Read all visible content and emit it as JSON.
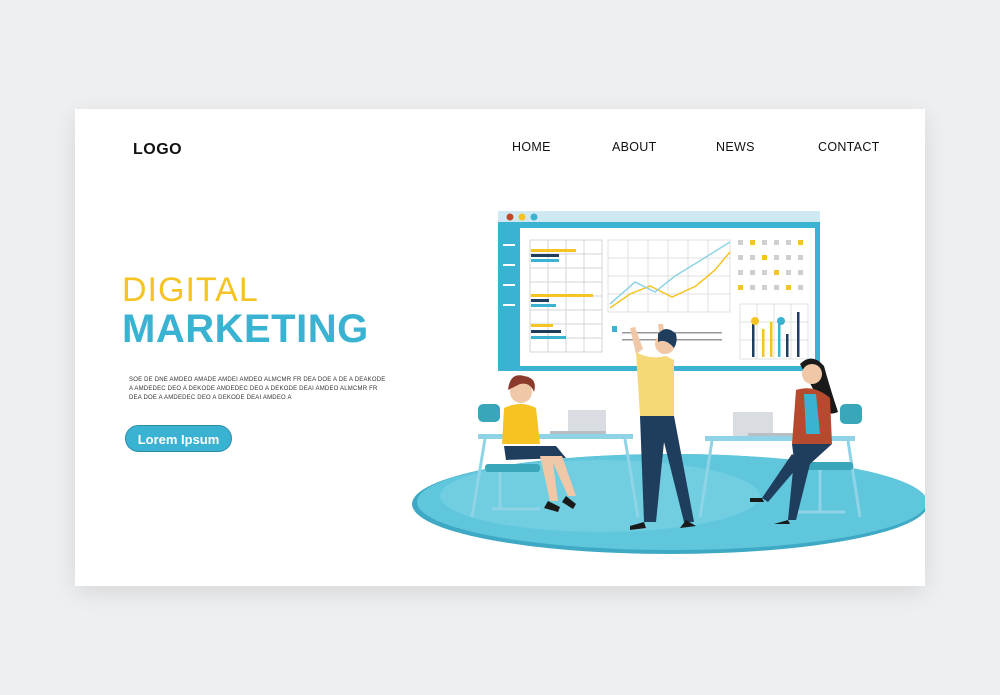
{
  "header": {
    "logo": "LOGO",
    "nav": {
      "home": "HOME",
      "about": "ABOUT",
      "news": "NEWS",
      "contact": "CONTACT"
    }
  },
  "hero": {
    "title_line1": "DIGITAL",
    "title_line2": "MARKETING",
    "body": "SOE DE DNE AMDEO AMADE AMDEI AMDEO ALMCMR FR DEA DOE A DE A DEAKODE A AMDEDEC DEO A DEKODE AMDEDEC DEO A DEKODE DEAI AMDEO ALMCMR FR DEA DOE A AMDEDEC DEO A DEKODE DEAI AMDEO A",
    "cta_label": "Lorem Ipsum"
  },
  "colors": {
    "accent_yellow": "#f5c322",
    "accent_blue": "#3ab3d3",
    "dark_navy": "#1f3d5c",
    "floor_teal": "#46b7cf"
  },
  "illustration": {
    "icons": [
      "browser-window-icon",
      "dashboard-chart-icon",
      "people-meeting-illustration"
    ]
  }
}
